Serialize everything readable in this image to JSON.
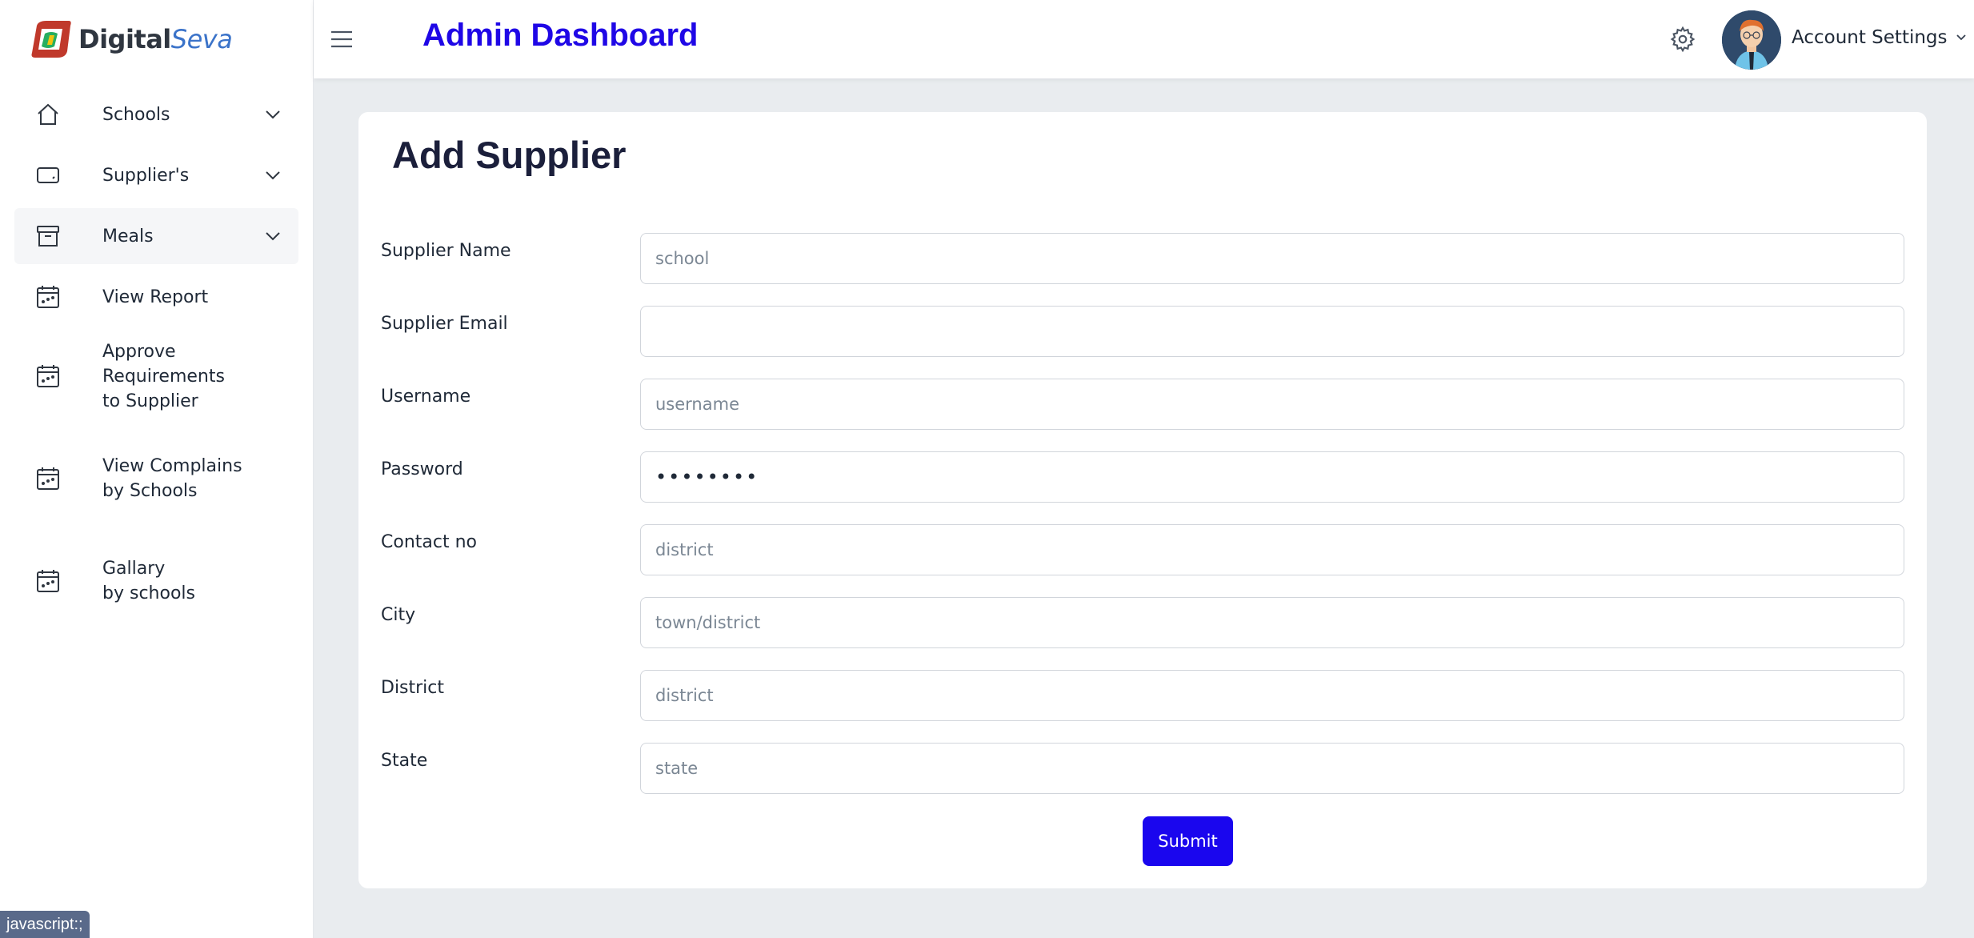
{
  "brand": {
    "name_bold": "Digital",
    "name_italic": "Seva"
  },
  "header": {
    "title": "Admin Dashboard",
    "account_label": "Account Settings"
  },
  "sidebar": {
    "items": [
      {
        "label": "Schools",
        "icon": "home-icon",
        "has_chevron": true
      },
      {
        "label": "Supplier's",
        "icon": "tablet-icon",
        "has_chevron": true
      },
      {
        "label": "Meals",
        "icon": "archive-icon",
        "has_chevron": true
      },
      {
        "label": "View Report",
        "icon": "calendar-icon"
      },
      {
        "label": "Approve Requirements\nto Supplier",
        "icon": "calendar-icon"
      },
      {
        "label": "View Complains\nby Schools",
        "icon": "calendar-icon"
      },
      {
        "label": "Gallary\nby schools",
        "icon": "calendar-icon"
      }
    ]
  },
  "form": {
    "title": "Add Supplier",
    "fields": [
      {
        "label": "Supplier Name",
        "placeholder": "school",
        "value": ""
      },
      {
        "label": "Supplier Email",
        "placeholder": "",
        "value": ""
      },
      {
        "label": "Username",
        "placeholder": "username",
        "value": ""
      },
      {
        "label": "Password",
        "placeholder": "",
        "value": "••••••••"
      },
      {
        "label": "Contact no",
        "placeholder": "district",
        "value": ""
      },
      {
        "label": "City",
        "placeholder": "town/district",
        "value": ""
      },
      {
        "label": "District",
        "placeholder": "district",
        "value": ""
      },
      {
        "label": "State",
        "placeholder": "state",
        "value": ""
      }
    ],
    "submit_label": "Submit"
  },
  "status_bar": {
    "text": "javascript:;"
  },
  "colors": {
    "accent": "#1a06ee",
    "title": "#1f07e6",
    "background": "#e9ecef"
  }
}
